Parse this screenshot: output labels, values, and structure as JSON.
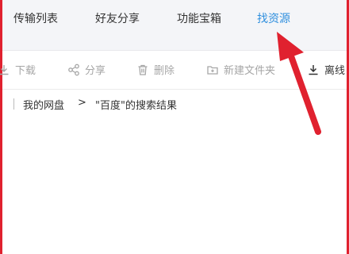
{
  "top_nav": {
    "items": [
      {
        "label": "传输列表"
      },
      {
        "label": "好友分享"
      },
      {
        "label": "功能宝箱"
      },
      {
        "label": "找资源"
      }
    ],
    "active_index": 3
  },
  "toolbar": {
    "download_label": "下载",
    "share_label": "分享",
    "delete_label": "删除",
    "new_folder_label": "新建文件夹",
    "offline_label": "离线"
  },
  "breadcrumb": {
    "root_label": "我的网盘",
    "separator": ">",
    "current_label": "\"百度\"的搜索结果"
  },
  "colors": {
    "active_nav": "#2f8fde",
    "annotation_red": "#e0212f",
    "disabled_text": "#a6a6a6"
  },
  "icons": {
    "download": "download-icon",
    "share": "share-icon",
    "delete": "trash-icon",
    "new_folder": "new-folder-icon",
    "offline": "offline-download-icon"
  }
}
